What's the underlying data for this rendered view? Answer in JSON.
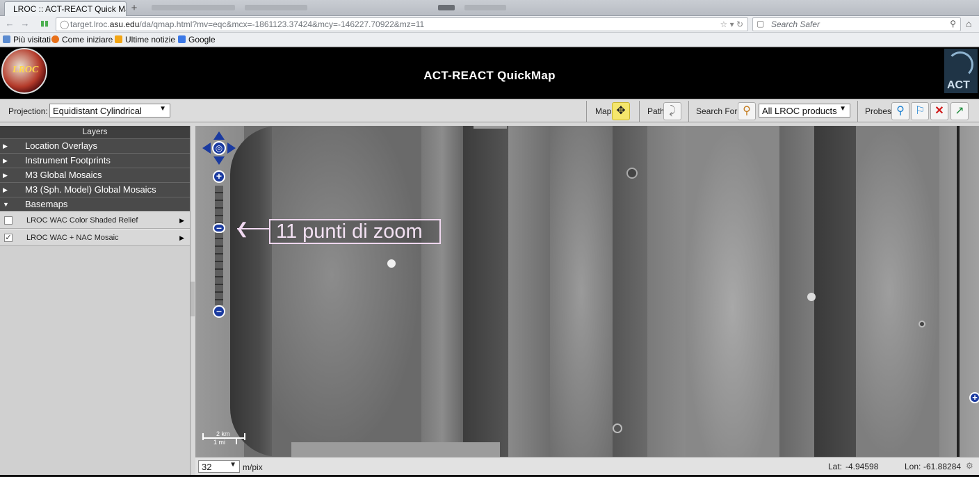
{
  "browser": {
    "tab_title": "LROC :: ACT-REACT Quick Map",
    "new_tab": "+",
    "url_prefix": "target.lroc.",
    "url_host": "asu.edu",
    "url_path": "/da/qmap.html?mv=eqc&mcx=-1861123.37424&mcy=-146227.70922&mz=11",
    "search_placeholder": "Search Safer"
  },
  "bookmarks": [
    {
      "label": "Più visitati",
      "icon_color": "#5b8bd0"
    },
    {
      "label": "Come iniziare",
      "icon_color": "#e8701a"
    },
    {
      "label": "Ultime notizie",
      "icon_color": "#f2a515"
    },
    {
      "label": "Google",
      "icon_color": "#3b78e7"
    }
  ],
  "app": {
    "title": "ACT-REACT QuickMap",
    "logo_text": "LROC",
    "act_logo_text": "ACT"
  },
  "toolbar": {
    "projection_label": "Projection:",
    "projection_value": "Equidistant Cylindrical",
    "map_label": "Map",
    "path_label": "Path",
    "search_label": "Search For:",
    "search_value": "All LROC products",
    "probes_label": "Probes"
  },
  "sidebar": {
    "header": "Layers",
    "groups": [
      {
        "label": "Location Overlays",
        "expanded": false
      },
      {
        "label": "Instrument Footprints",
        "expanded": false
      },
      {
        "label": "M3 Global Mosaics",
        "expanded": false
      },
      {
        "label": "M3 (Sph. Model) Global Mosaics",
        "expanded": false
      },
      {
        "label": "Basemaps",
        "expanded": true
      }
    ],
    "basemaps": [
      {
        "label": "LROC WAC Color Shaded Relief",
        "checked": false
      },
      {
        "label": "LROC WAC + NAC Mosaic",
        "checked": true
      }
    ]
  },
  "map": {
    "annotation": "11 punti di zoom",
    "scale_km": "2 km",
    "scale_mi": "1 mi"
  },
  "status": {
    "resolution": "32",
    "resolution_unit": "m/pix",
    "lat_label": "Lat:",
    "lat_value": "-4.94598",
    "lon_label": "Lon:",
    "lon_value": "-61.88284"
  },
  "colors": {
    "accent_blue": "#1a3aa0",
    "active_tool": "#f5e66c",
    "header_bg": "#000000"
  }
}
